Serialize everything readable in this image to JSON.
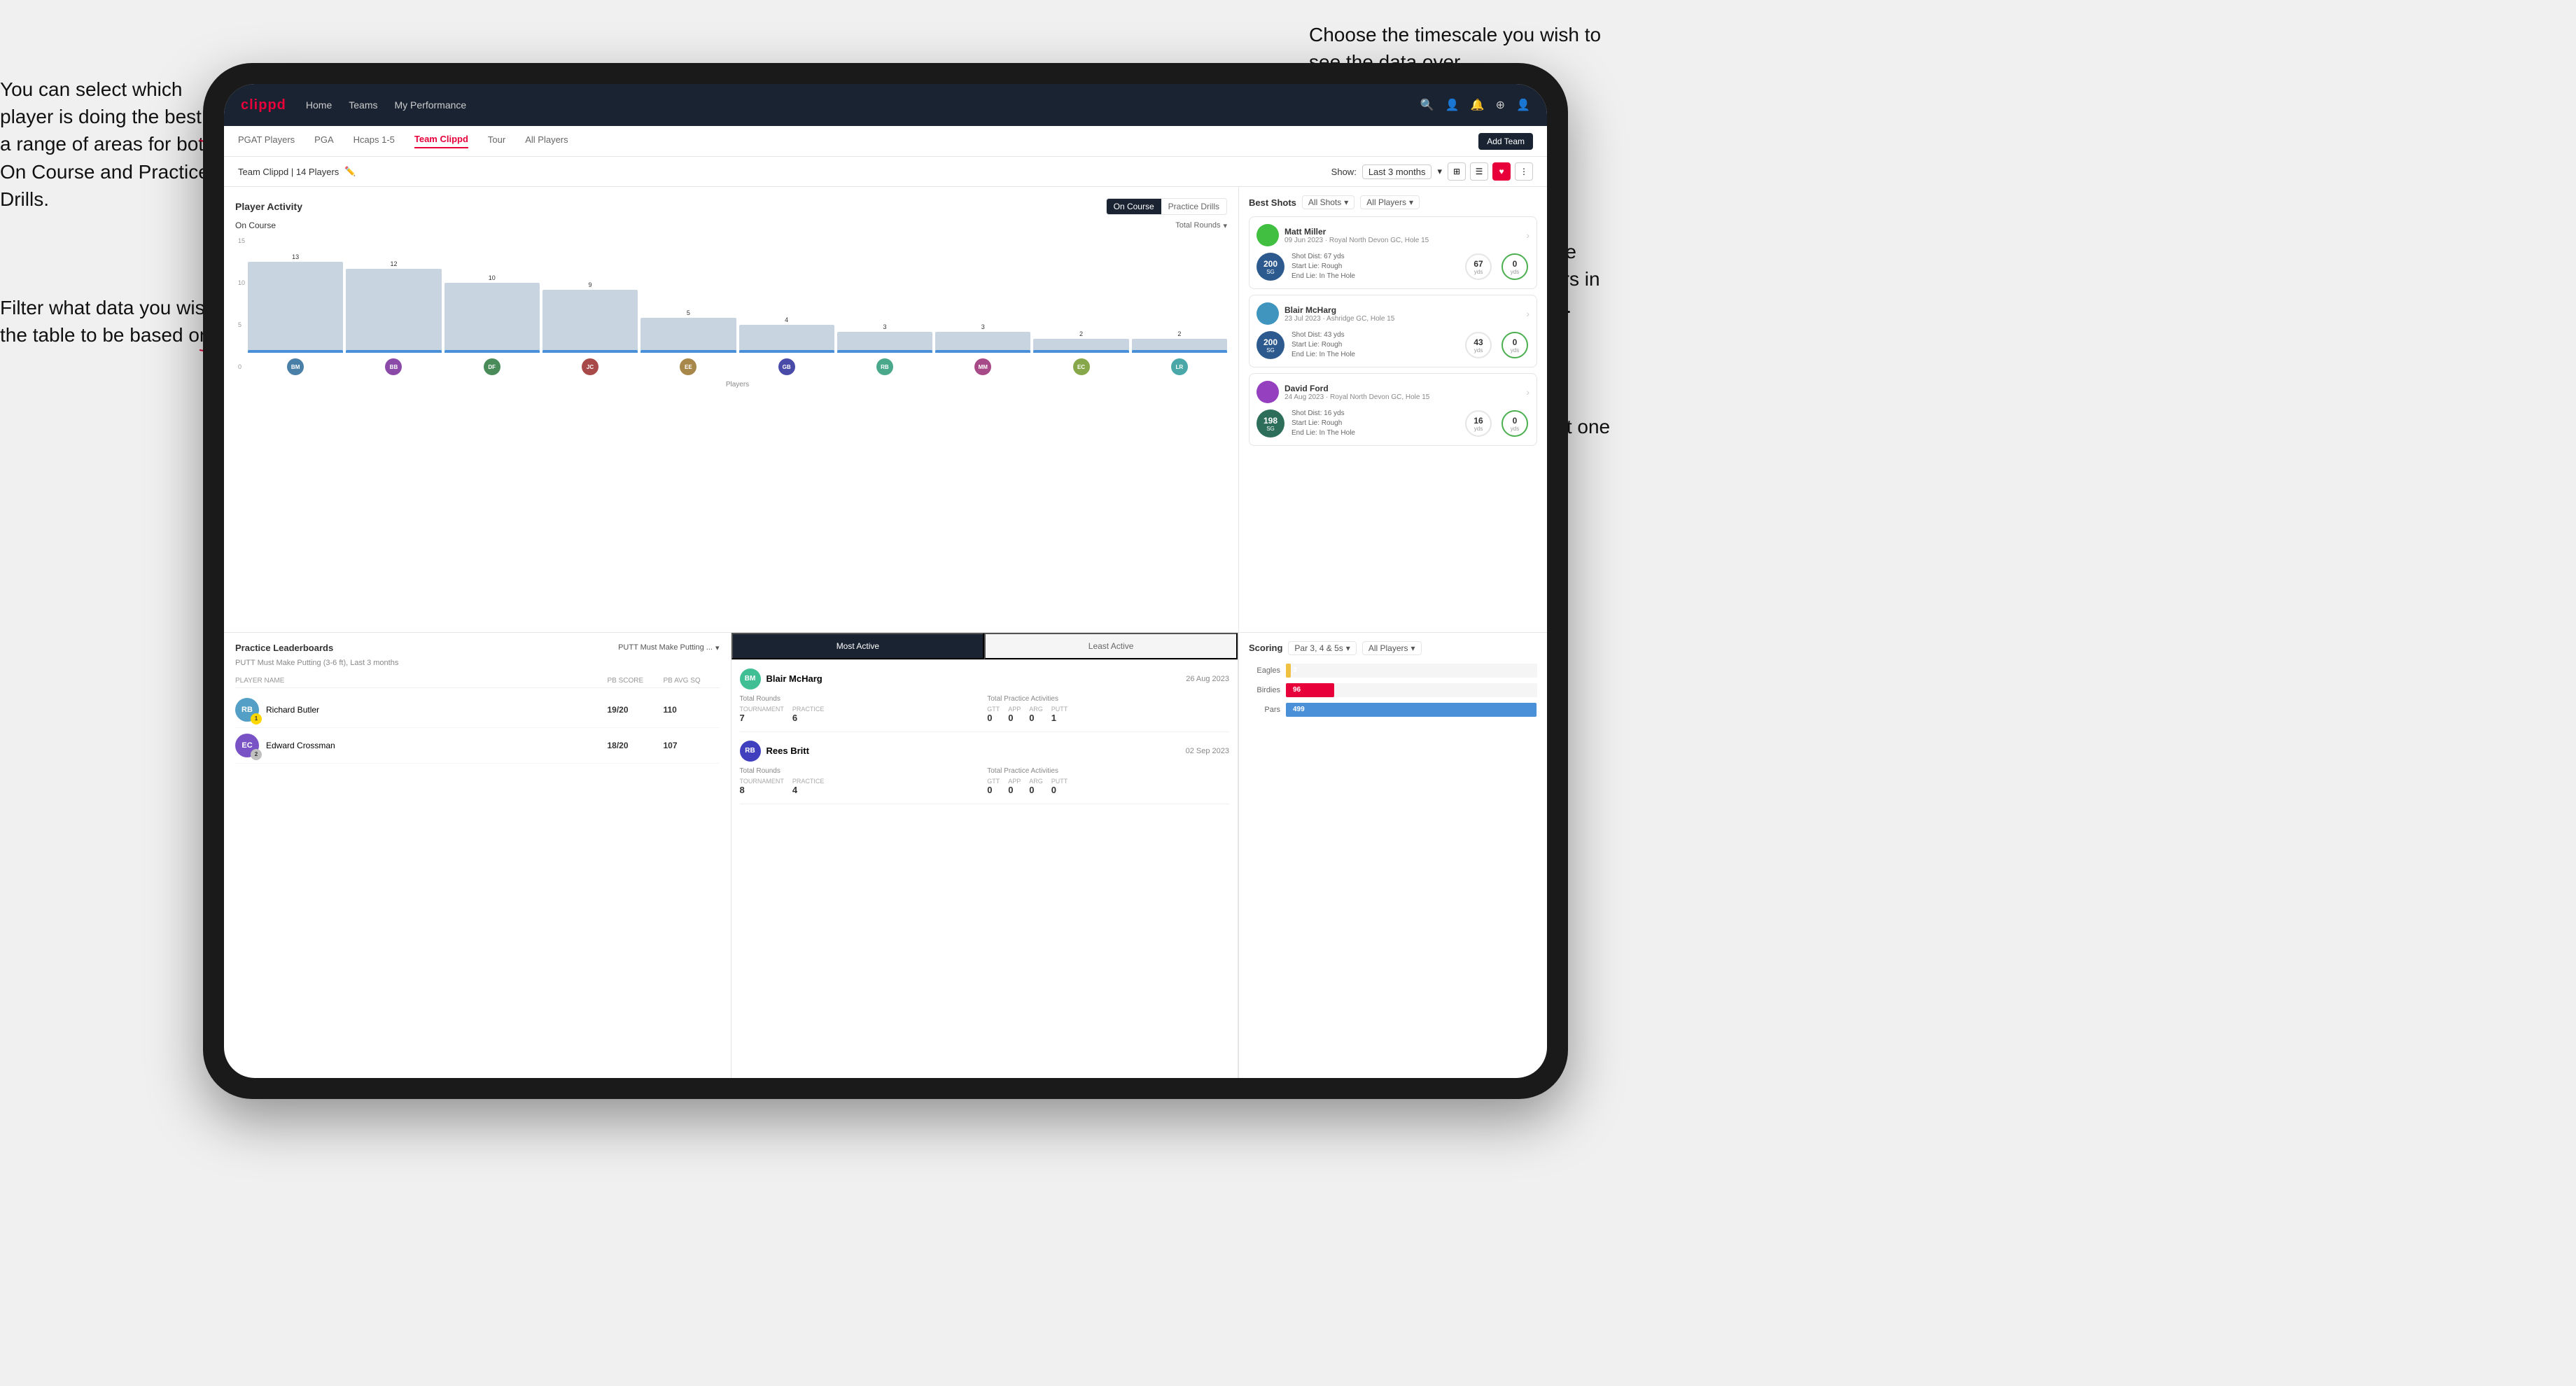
{
  "annotations": {
    "a1": "You can select which player is\ndoing the best in a range of\nareas for both On Course and\nPractice Drills.",
    "a2": "Choose the timescale you\nwish to see the data over.",
    "a3": "Filter what data you wish the\ntable to be based on.",
    "a4": "Here you can see who's hit\nthe best shots out of all the\nplayers in the team for\neach department.",
    "a5": "You can also filter to show\njust one player's best shots."
  },
  "nav": {
    "logo": "clippd",
    "items": [
      "Home",
      "Teams",
      "My Performance"
    ],
    "icons": [
      "🔍",
      "👤",
      "🔔",
      "⊕",
      "👤"
    ]
  },
  "subnav": {
    "items": [
      "PGAT Players",
      "PGA",
      "Hcaps 1-5",
      "Team Clippd",
      "Tour",
      "All Players"
    ],
    "active": "Team Clippd",
    "add_btn": "Add Team"
  },
  "team_header": {
    "label": "Team Clippd | 14 Players",
    "show_label": "Show:",
    "timescale": "Last 3 months"
  },
  "player_activity": {
    "title": "Player Activity",
    "toggle": [
      "On Course",
      "Practice Drills"
    ],
    "active_toggle": "On Course",
    "chart_label": "On Course",
    "filter_label": "Total Rounds",
    "x_label": "Players",
    "y_label": "Total Rounds",
    "bars": [
      {
        "name": "B. McHarg",
        "value": 13,
        "initials": "BM",
        "color": "#7ba7c9"
      },
      {
        "name": "B. Britt",
        "value": 12,
        "initials": "BB",
        "color": "#7ba7c9"
      },
      {
        "name": "D. Ford",
        "value": 10,
        "initials": "DF",
        "color": "#7ba7c9"
      },
      {
        "name": "J. Coles",
        "value": 9,
        "initials": "JC",
        "color": "#7ba7c9"
      },
      {
        "name": "E. Ebert",
        "value": 5,
        "initials": "EE",
        "color": "#7ba7c9"
      },
      {
        "name": "G. Billingham",
        "value": 4,
        "initials": "GB",
        "color": "#7ba7c9"
      },
      {
        "name": "R. Butler",
        "value": 3,
        "initials": "RB",
        "color": "#7ba7c9"
      },
      {
        "name": "M. Miller",
        "value": 3,
        "initials": "MM",
        "color": "#7ba7c9"
      },
      {
        "name": "E. Crossman",
        "value": 2,
        "initials": "EC",
        "color": "#7ba7c9"
      },
      {
        "name": "L. Robertson",
        "value": 2,
        "initials": "LR",
        "color": "#7ba7c9"
      }
    ],
    "max_value": 15
  },
  "best_shots": {
    "title": "Best Shots",
    "filters": [
      "All Shots",
      "All Players"
    ],
    "players": [
      {
        "name": "Matt Miller",
        "detail": "09 Jun 2023 · Royal North Devon GC, Hole 15",
        "badge_val": "200",
        "badge_sub": "SG",
        "badge_color": "blue",
        "shot_dist": "Shot Dist: 67 yds",
        "start_lie": "Start Lie: Rough",
        "end_lie": "End Lie: In The Hole",
        "metric1_val": "67",
        "metric1_unit": "yds",
        "metric2_val": "0",
        "metric2_unit": "yds"
      },
      {
        "name": "Blair McHarg",
        "detail": "23 Jul 2023 · Ashridge GC, Hole 15",
        "badge_val": "200",
        "badge_sub": "SG",
        "badge_color": "blue",
        "shot_dist": "Shot Dist: 43 yds",
        "start_lie": "Start Lie: Rough",
        "end_lie": "End Lie: In The Hole",
        "metric1_val": "43",
        "metric1_unit": "yds",
        "metric2_val": "0",
        "metric2_unit": "yds"
      },
      {
        "name": "David Ford",
        "detail": "24 Aug 2023 · Royal North Devon GC, Hole 15",
        "badge_val": "198",
        "badge_sub": "SG",
        "badge_color": "green",
        "shot_dist": "Shot Dist: 16 yds",
        "start_lie": "Start Lie: Rough",
        "end_lie": "End Lie: In The Hole",
        "metric1_val": "16",
        "metric1_unit": "yds",
        "metric2_val": "0",
        "metric2_unit": "yds"
      }
    ]
  },
  "practice_leaderboards": {
    "title": "Practice Leaderboards",
    "filter": "PUTT Must Make Putting ...",
    "subtitle": "PUTT Must Make Putting (3-6 ft), Last 3 months",
    "columns": [
      "Player Name",
      "PB Score",
      "PB Avg SQ"
    ],
    "rows": [
      {
        "rank": 1,
        "name": "Richard Butler",
        "pb_score": "19/20",
        "pb_avg": "110",
        "initials": "RB"
      },
      {
        "rank": 2,
        "name": "Edward Crossman",
        "pb_score": "18/20",
        "pb_avg": "107",
        "initials": "EC"
      }
    ]
  },
  "most_active": {
    "tabs": [
      "Most Active",
      "Least Active"
    ],
    "active_tab": "Most Active",
    "players": [
      {
        "name": "Blair McHarg",
        "date": "26 Aug 2023",
        "total_rounds_label": "Total Rounds",
        "tournament": "7",
        "practice": "6",
        "total_practice_label": "Total Practice Activities",
        "gtt": "0",
        "app": "0",
        "arg": "0",
        "putt": "1"
      },
      {
        "name": "Rees Britt",
        "date": "02 Sep 2023",
        "total_rounds_label": "Total Rounds",
        "tournament": "8",
        "practice": "4",
        "total_practice_label": "Total Practice Activities",
        "gtt": "0",
        "app": "0",
        "arg": "0",
        "putt": "0"
      }
    ]
  },
  "scoring": {
    "title": "Scoring",
    "filter1": "Par 3, 4 & 5s",
    "filter2": "All Players",
    "rows": [
      {
        "label": "Eagles",
        "value": 3,
        "max": 500,
        "color": "#f0c040",
        "text_outside": true
      },
      {
        "label": "Birdies",
        "value": 96,
        "max": 500,
        "color": "#e8003a"
      },
      {
        "label": "Pars",
        "value": 499,
        "max": 500,
        "color": "#4a90d9"
      }
    ]
  }
}
